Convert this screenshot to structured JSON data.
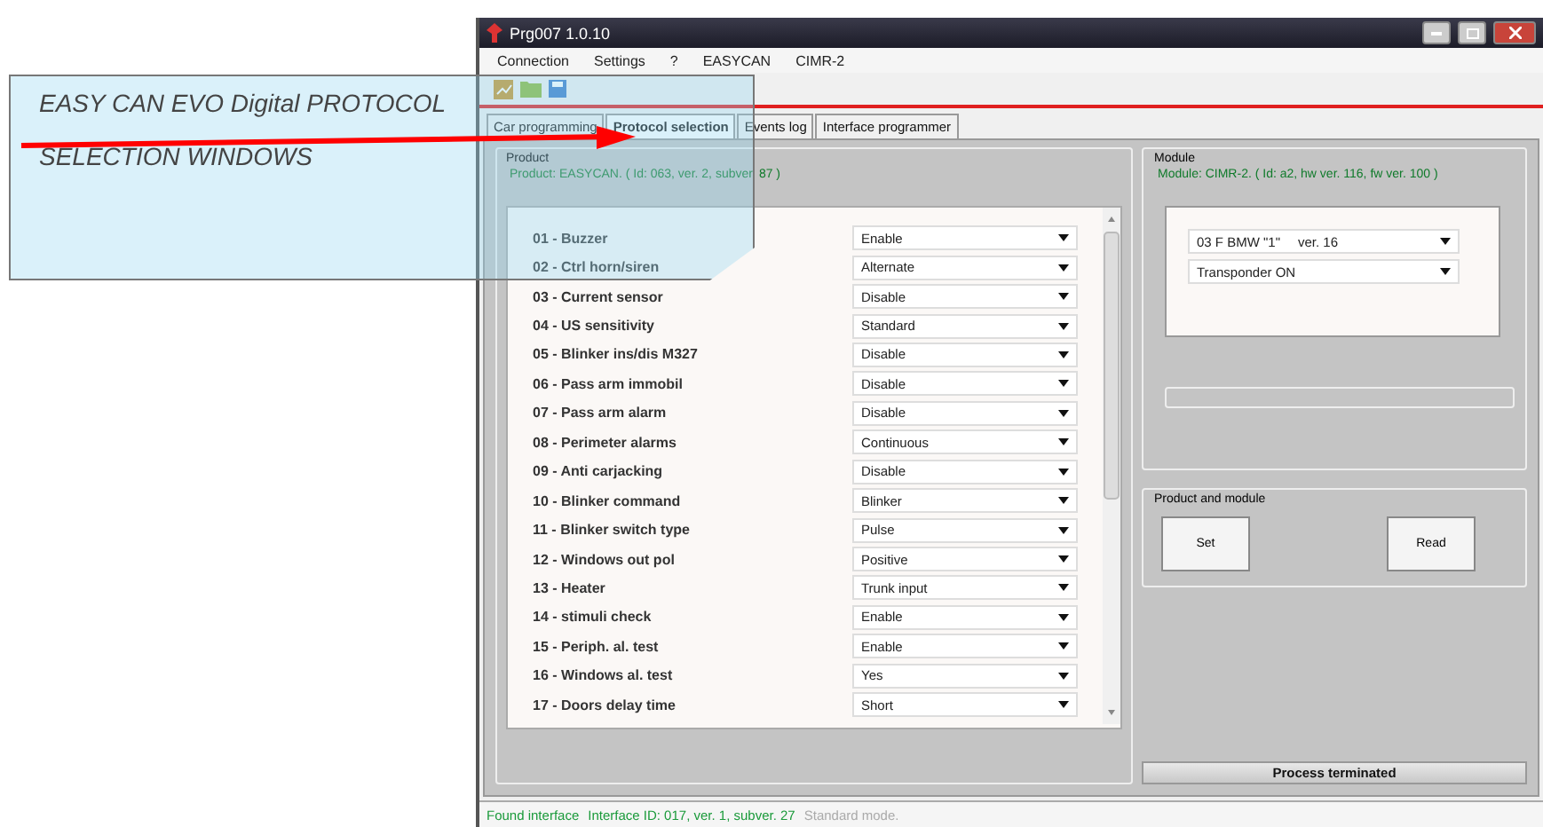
{
  "window": {
    "title": "Prg007  1.0.10"
  },
  "menu": [
    "Connection",
    "Settings",
    "?",
    "EASYCAN",
    "CIMR-2"
  ],
  "tabs": [
    {
      "label": "Car programming",
      "selected": false
    },
    {
      "label": "Protocol selection",
      "selected": true
    },
    {
      "label": "Events log",
      "selected": false
    },
    {
      "label": "Interface programmer",
      "selected": false
    }
  ],
  "product": {
    "group_label": "Product",
    "info": "Product: EASYCAN. ( Id: 063, ver. 2, subver. 87 )",
    "settings": [
      {
        "label": "01 - Buzzer",
        "value": "Enable"
      },
      {
        "label": "02 - Ctrl horn/siren",
        "value": "Alternate"
      },
      {
        "label": "03 - Current sensor",
        "value": "Disable"
      },
      {
        "label": "04 - US sensitivity",
        "value": "Standard"
      },
      {
        "label": "05 - Blinker ins/dis M327",
        "value": "Disable"
      },
      {
        "label": "06 - Pass arm immobil",
        "value": "Disable"
      },
      {
        "label": "07 - Pass arm alarm",
        "value": "Disable"
      },
      {
        "label": "08 - Perimeter alarms",
        "value": "Continuous"
      },
      {
        "label": "09 - Anti carjacking",
        "value": "Disable"
      },
      {
        "label": "10 - Blinker command",
        "value": "Blinker"
      },
      {
        "label": "11 - Blinker switch type",
        "value": "Pulse"
      },
      {
        "label": "12 - Windows out pol",
        "value": "Positive"
      },
      {
        "label": "13 - Heater",
        "value": "Trunk input"
      },
      {
        "label": "14 - stimuli check",
        "value": "Enable"
      },
      {
        "label": "15 - Periph. al. test",
        "value": "Enable"
      },
      {
        "label": "16 - Windows al. test",
        "value": "Yes"
      },
      {
        "label": "17 - Doors delay time",
        "value": "Short"
      }
    ]
  },
  "module": {
    "group_label": "Module",
    "info": "Module: CIMR-2. ( Id: a2, hw ver. 116, fw ver. 100 )",
    "selects": [
      {
        "value": "03  F  BMW \"1\"",
        "version": "ver. 16"
      },
      {
        "value": "Transponder ON"
      }
    ]
  },
  "product_and_module": {
    "group_label": "Product and module",
    "buttons": [
      "Set",
      "Read"
    ]
  },
  "process_status": "Process terminated",
  "status_bar": [
    {
      "text": "Found interface",
      "kind": "ok"
    },
    {
      "text": "Interface ID: 017, ver. 1, subver. 27",
      "kind": "ok"
    },
    {
      "text": "Standard mode.",
      "kind": "muted"
    }
  ],
  "module_progress": {
    "level": 0
  },
  "callout": {
    "lines": [
      "EASY CAN EVO Digital PROTOCOL",
      "SELECTION WINDOWS"
    ]
  }
}
